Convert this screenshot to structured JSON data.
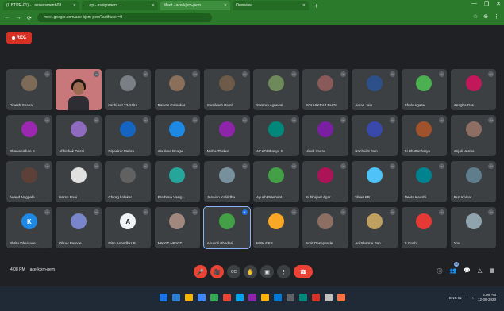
{
  "browser": {
    "tabs": [
      {
        "title": "(L.BTPR-01) - ..assessment-03",
        "active": false
      },
      {
        "title": "... ep - assignment ...",
        "active": false
      },
      {
        "title": "Meet - ace-kjxm-pem",
        "active": true
      },
      {
        "title": "Overview",
        "active": false
      }
    ],
    "new_tab": "+",
    "address": "meet.google.com/ace-kjxm-pem?authuser=0",
    "window_controls": [
      "—",
      "❐",
      "✕"
    ],
    "nav_icons": [
      "←",
      "→",
      "⟳"
    ],
    "toolbar_icons": [
      "☆",
      "⊕",
      "⋮"
    ]
  },
  "meeting": {
    "rec_label": "REC",
    "participants": [
      {
        "name": "Dinesh Shaha",
        "initial": "",
        "color": "#7e6b57",
        "mic": "muted"
      },
      {
        "name": "",
        "initial": "",
        "color": "",
        "video": true,
        "mic": "muted"
      },
      {
        "name": "Lakhi sat 23-24/IA",
        "initial": "",
        "color": "#7a7f86",
        "mic": "muted"
      },
      {
        "name": "Biswas Gamekar",
        "initial": "",
        "color": "#8a6f5a",
        "mic": "muted"
      },
      {
        "name": "Samikesh Patel",
        "initial": "",
        "color": "#6e5a48",
        "mic": "muted"
      },
      {
        "name": "Somnm Agrawal",
        "initial": "",
        "color": "#6f8a5a",
        "mic": "muted"
      },
      {
        "name": "SOUVIKRAJ BHOI",
        "initial": "",
        "color": "#8a5a5a",
        "mic": "muted"
      },
      {
        "name": "Aman Jain",
        "initial": "",
        "color": "#2d4f8a",
        "mic": "muted"
      },
      {
        "name": "Shalu Agarw",
        "initial": "",
        "color": "#4caf50",
        "mic": "muted"
      },
      {
        "name": "Anagha Das",
        "initial": "",
        "color": "#c2185b",
        "mic": "muted"
      },
      {
        "name": "Bhawanishan S...",
        "initial": "",
        "color": "#9c27b0",
        "mic": "muted"
      },
      {
        "name": "Abhishek Desai",
        "initial": "",
        "color": "#8e6bbf",
        "mic": "muted"
      },
      {
        "name": "Dipankar Mehra",
        "initial": "",
        "color": "#1565c0",
        "mic": "muted"
      },
      {
        "name": "Anurima Bhagw...",
        "initial": "",
        "color": "#1e88e5",
        "mic": "muted"
      },
      {
        "name": "Nisha Thakur",
        "initial": "",
        "color": "#8e24aa",
        "mic": "muted"
      },
      {
        "name": "ACAD Bhavya S...",
        "initial": "",
        "color": "#00897b",
        "mic": "muted"
      },
      {
        "name": "Vivek Yadav",
        "initial": "",
        "color": "#7b1fa2",
        "mic": "muted"
      },
      {
        "name": "Rachel S Jain",
        "initial": "",
        "color": "#3949ab",
        "mic": "muted"
      },
      {
        "name": "Bi Bhattacharya",
        "initial": "",
        "color": "#a0522d",
        "mic": "muted"
      },
      {
        "name": "Anjali Verma",
        "initial": "",
        "color": "#8d6e63",
        "mic": "muted"
      },
      {
        "name": "Anand Nagpale",
        "initial": "",
        "color": "#5d4037",
        "mic": "muted"
      },
      {
        "name": "Harsh Ravi",
        "initial": "",
        "color": "#e0e0e0",
        "mic": "muted"
      },
      {
        "name": "Chirag kolekar",
        "initial": "",
        "color": "#616161",
        "mic": "muted"
      },
      {
        "name": "Prathima Vasig...",
        "initial": "",
        "color": "#26a69a",
        "mic": "muted"
      },
      {
        "name": "Junaidn Kaliridha",
        "initial": "",
        "color": "#78909c",
        "mic": "muted"
      },
      {
        "name": "Ayush Prashant...",
        "initial": "",
        "color": "#43a047",
        "mic": "muted"
      },
      {
        "name": "Subhajeet Agar...",
        "initial": "",
        "color": "#ad1457",
        "mic": "muted"
      },
      {
        "name": "Vikas KR",
        "initial": "",
        "color": "#4fc3f7",
        "mic": "muted"
      },
      {
        "name": "Neeta Kaushi...",
        "initial": "",
        "color": "#00838f",
        "mic": "muted"
      },
      {
        "name": "Ruti Kalkar",
        "initial": "",
        "color": "#607d8b",
        "mic": "muted"
      },
      {
        "name": "Bhritu Dhaidave...",
        "initial": "K",
        "color": "#1e88e5",
        "mic": "muted"
      },
      {
        "name": "Dhruv Barode",
        "initial": "",
        "color": "#7986cb",
        "mic": "muted"
      },
      {
        "name": "Nitin Anandhkr R...",
        "initial": "A",
        "color": "white",
        "mic": "muted"
      },
      {
        "name": "NIKKIT NIKKIT",
        "initial": "",
        "color": "#a1887f",
        "mic": "muted"
      },
      {
        "name": "Anukriti Bhadari",
        "initial": "",
        "color": "#43a047",
        "mic": "active",
        "highlight": true
      },
      {
        "name": "MRK RES",
        "initial": "",
        "color": "#f9a825",
        "mic": "muted"
      },
      {
        "name": "Arpit Deshpande",
        "initial": "",
        "color": "#8d6e63",
        "mic": "muted"
      },
      {
        "name": "Ari Sharma Pan...",
        "initial": "",
        "color": "#c0a060",
        "mic": "muted"
      },
      {
        "name": "S Gnsh",
        "initial": "",
        "color": "#e53935",
        "mic": "muted"
      },
      {
        "name": "You",
        "initial": "",
        "color": "#90a4ae",
        "mic": "muted"
      }
    ],
    "time": "4:08 PM",
    "meeting_code": "ace-kjxm-pem",
    "controls": [
      "🎤",
      "🎥",
      "CC",
      "✋",
      "▣",
      "⋮",
      "☎"
    ],
    "right_controls": [
      "ⓘ",
      "👥",
      "💬",
      "△",
      "▦"
    ],
    "people_count": "40"
  },
  "taskbar": {
    "icons": [
      "#1a73e8",
      "#2d7fd3",
      "#f4b400",
      "#4285f4",
      "#34a853",
      "#ea4335",
      "#00a4ef",
      "#8e24aa",
      "#ffb300",
      "#0078d4",
      "#5f6368",
      "#00897b",
      "#d93025",
      "#c0c0c0",
      "#ff7043"
    ],
    "tray_text": "ENG IN",
    "time": "4:08 PM",
    "date": "12-09-2023"
  }
}
